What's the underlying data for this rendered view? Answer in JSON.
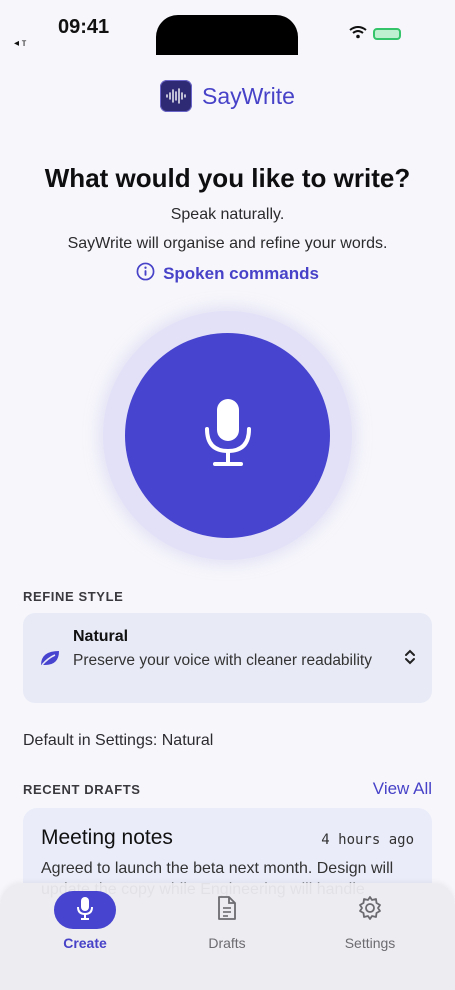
{
  "status": {
    "time": "09:41",
    "back": "◂ ᴛ"
  },
  "brand": {
    "name": "SayWrite"
  },
  "prompt": {
    "title": "What would you like to write?",
    "line1": "Speak naturally.",
    "line2": "SayWrite will organise and refine your words.",
    "commands_link": "Spoken commands"
  },
  "refine": {
    "section_label": "REFINE STYLE",
    "style_name": "Natural",
    "style_desc": "Preserve your voice with cleaner readability",
    "default_note": "Default in Settings: Natural"
  },
  "drafts": {
    "section_label": "RECENT DRAFTS",
    "view_all": "View All",
    "items": [
      {
        "title": "Meeting notes",
        "time": "4 hours ago",
        "excerpt": "Agreed to launch the beta next month. Design will update the copy while Engineering will handle"
      }
    ]
  },
  "tabs": [
    {
      "label": "Create",
      "icon": "mic-icon",
      "active": true
    },
    {
      "label": "Drafts",
      "icon": "document-icon",
      "active": false
    },
    {
      "label": "Settings",
      "icon": "gear-icon",
      "active": false
    }
  ],
  "colors": {
    "accent": "#4744cf",
    "background": "#f7f7fb",
    "card": "#e8eaf6"
  }
}
